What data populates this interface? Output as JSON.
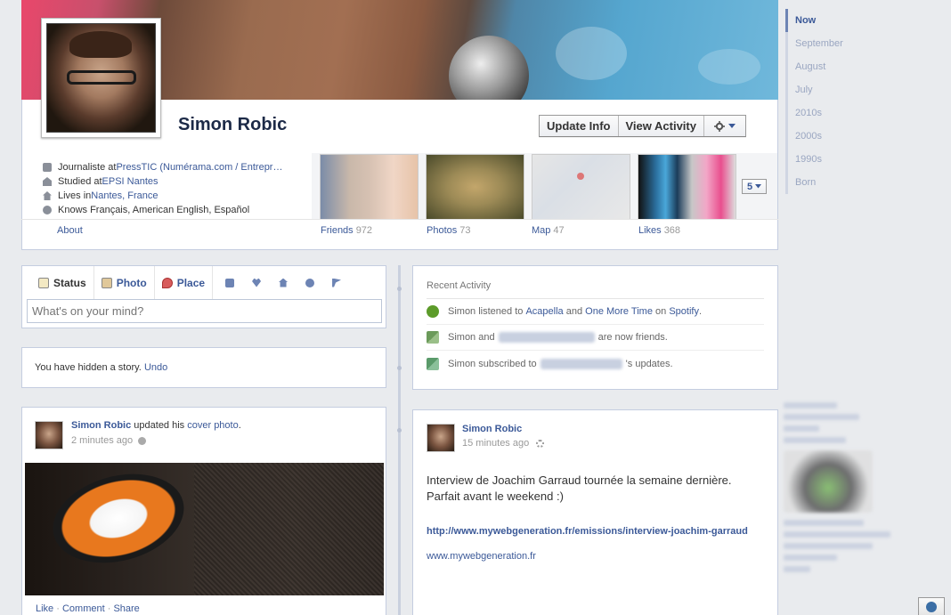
{
  "profile": {
    "name": "Simon Robic",
    "buttons": {
      "update_info": "Update Info",
      "view_activity": "View Activity"
    },
    "info": [
      {
        "icon": "briefcase-icon",
        "prefix": "Journaliste at ",
        "link": "PressTIC (Numérama.com / Entrepr…"
      },
      {
        "icon": "school-icon",
        "prefix": "Studied at ",
        "link": "EPSI Nantes"
      },
      {
        "icon": "home-icon",
        "prefix": "Lives in ",
        "link": "Nantes, France"
      },
      {
        "icon": "globe-icon",
        "prefix": "Knows Français, American English, Español",
        "link": ""
      }
    ],
    "about_label": "About",
    "tiles": {
      "friends": {
        "label": "Friends",
        "count": "972"
      },
      "photos": {
        "label": "Photos",
        "count": "73"
      },
      "map": {
        "label": "Map",
        "count": "47"
      },
      "likes": {
        "label": "Likes",
        "count": "368"
      }
    },
    "more_count": "5"
  },
  "composer": {
    "tabs": {
      "status": "Status",
      "photo": "Photo",
      "place": "Place"
    },
    "placeholder": "What's on your mind?"
  },
  "hidden_story": {
    "text": "You have hidden a story. ",
    "undo": "Undo"
  },
  "recent_activity": {
    "title": "Recent Activity",
    "items": [
      {
        "pre": "Simon listened to ",
        "a": "Acapella",
        "mid": " and ",
        "b": "One More Time",
        "mid2": " on ",
        "c": "Spotify",
        "post": "."
      },
      {
        "pre": "Simon and ",
        "post": " are now friends."
      },
      {
        "pre": "Simon subscribed to ",
        "post": "'s updates."
      }
    ]
  },
  "post_left": {
    "author": "Simon Robic",
    "action": " updated his ",
    "link": "cover photo",
    "end": ".",
    "time": "2 minutes ago",
    "actions": {
      "like": "Like",
      "comment": "Comment",
      "share": "Share",
      "sep": " · "
    }
  },
  "post_right": {
    "author": "Simon Robic",
    "time": "15 minutes ago",
    "message": "Interview de Joachim Garraud tournée la semaine dernière. Parfait avant le weekend :)",
    "link_title": "http://www.mywebgeneration.fr/emissions/interview-joachim-garraud",
    "link_domain": "www.mywebgeneration.fr"
  },
  "date_nav": [
    "Now",
    "September",
    "August",
    "July",
    "2010s",
    "2000s",
    "1990s",
    "Born"
  ],
  "colors": {
    "link": "#3b5998",
    "border": "#c4cde0",
    "background": "#e9ebee"
  }
}
